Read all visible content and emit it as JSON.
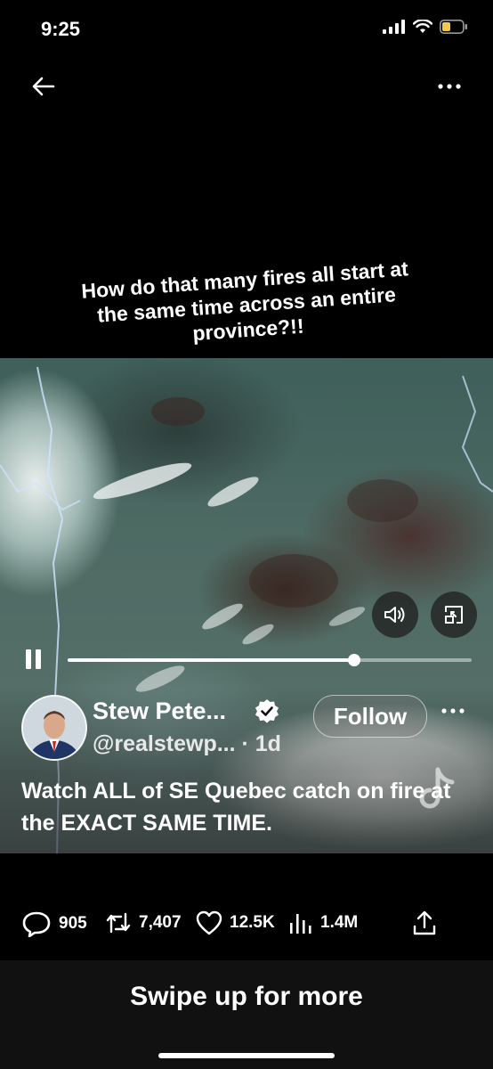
{
  "status_bar": {
    "time": "9:25",
    "icons": [
      "signal-icon",
      "wifi-icon",
      "battery-icon"
    ],
    "battery_color": "#f2c94c"
  },
  "nav": {
    "back_icon": "back-arrow-icon",
    "more_icon": "more-horizontal-icon"
  },
  "video": {
    "caption_lines": [
      "How do that many fires all start at",
      "the same time across an entire",
      "province?!!"
    ],
    "progress": 0.71,
    "playing": true
  },
  "author": {
    "name": "Stew Pete...",
    "handle": "@realstewp...",
    "time": "· 1d",
    "verified": true,
    "follow_label": "Follow"
  },
  "post": {
    "text": "Watch ALL of SE Quebec catch on fire at the EXACT SAME TIME."
  },
  "actions": {
    "replies": "905",
    "reposts": "7,407",
    "likes": "12.5K",
    "views": "1.4M"
  },
  "footer": {
    "swipe_label": "Swipe up for more"
  },
  "colors": {
    "background": "#000000",
    "text": "#ffffff",
    "bottom_bar": "#111111"
  }
}
